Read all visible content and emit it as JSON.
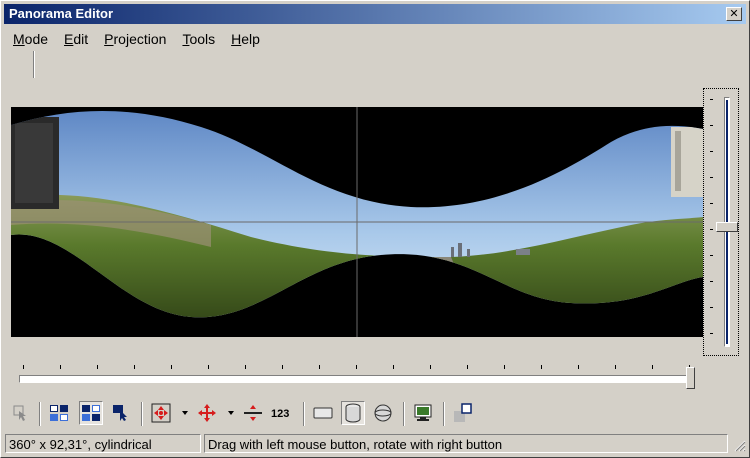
{
  "window": {
    "title": "Panorama Editor",
    "close_glyph": "✕"
  },
  "menu": [
    {
      "mnemonic": "M",
      "rest": "ode"
    },
    {
      "mnemonic": "E",
      "rest": "dit"
    },
    {
      "mnemonic": "P",
      "rest": "rojection"
    },
    {
      "mnemonic": "T",
      "rest": "ools"
    },
    {
      "mnemonic": "H",
      "rest": "elp"
    }
  ],
  "colors": {
    "title_start": "#0a246a",
    "title_end": "#a6caf0",
    "face": "#d4d0c8",
    "preview_bg": "#000000",
    "sky": "#9fc3e6",
    "grass": "#4f6a2a"
  },
  "toolbar": {
    "number_label": "123",
    "icons": [
      "select-arrow-icon",
      "identify-images-icon",
      "control-points-icon",
      "layout-icon",
      "centre-icon",
      "move-drag-icon",
      "straighten-icon",
      "number-icon",
      "rectilinear-icon",
      "cylindrical-icon",
      "equirectangular-icon",
      "preview-monitor-icon",
      "crop-icon"
    ]
  },
  "status": {
    "field_of_view": "360° x 92,31°, cylindrical",
    "hint": "Drag with left mouse button, rotate with right button"
  },
  "vertical_fov_slider": {
    "value_fraction": 0.54
  },
  "horizontal_fov_slider": {
    "value_fraction": 1.0
  }
}
